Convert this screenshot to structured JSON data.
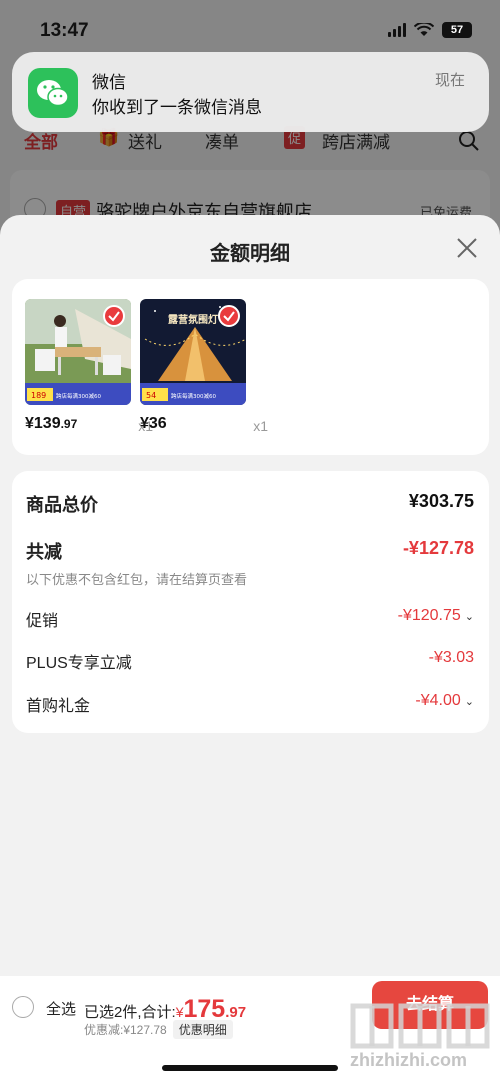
{
  "status_bar": {
    "time": "13:47",
    "battery": "57"
  },
  "background": {
    "tabs": [
      "全部",
      "送礼",
      "凑单",
      "跨店满减"
    ],
    "promo_badge": "促",
    "shop_badge": "自营",
    "shop_name": "骆驼牌户外京东自营旗舰店",
    "shipping": "已免运费"
  },
  "notification": {
    "app": "微信",
    "message": "你收到了一条微信消息",
    "time": "现在"
  },
  "sheet": {
    "title": "金额明细",
    "products": [
      {
        "price_int": "¥139",
        "price_dec": ".97",
        "qty": "x1",
        "img_price": "189",
        "img_promo": "跨店每满300减60"
      },
      {
        "price_int": "¥36",
        "price_dec": "",
        "qty": "x1",
        "img_price": "54",
        "img_promo": "跨店每满300减60",
        "img_title": "露营氛围灯"
      }
    ],
    "summary": {
      "total_label": "商品总价",
      "total_value": "¥303.75",
      "discount_label": "共减",
      "discount_value": "-¥127.78",
      "note": "以下优惠不包含红包，请在结算页查看",
      "items": [
        {
          "label": "促销",
          "value": "-¥120.75",
          "expandable": true
        },
        {
          "label": "PLUS专享立减",
          "value": "-¥3.03",
          "expandable": false
        },
        {
          "label": "首购礼金",
          "value": "-¥4.00",
          "expandable": true
        }
      ]
    }
  },
  "bottom": {
    "select_all": "全选",
    "selected": "已选2件,合计:",
    "total_symbol": "¥",
    "total_int": "175",
    "total_dec": ".97",
    "discount": "优惠减:¥127.78",
    "detail_btn": "优惠明细",
    "checkout": "去结算"
  },
  "watermark": "zhizhizhi.com",
  "colors": {
    "accent_red": "#e4393c",
    "wechat_green": "#2dc15b"
  }
}
